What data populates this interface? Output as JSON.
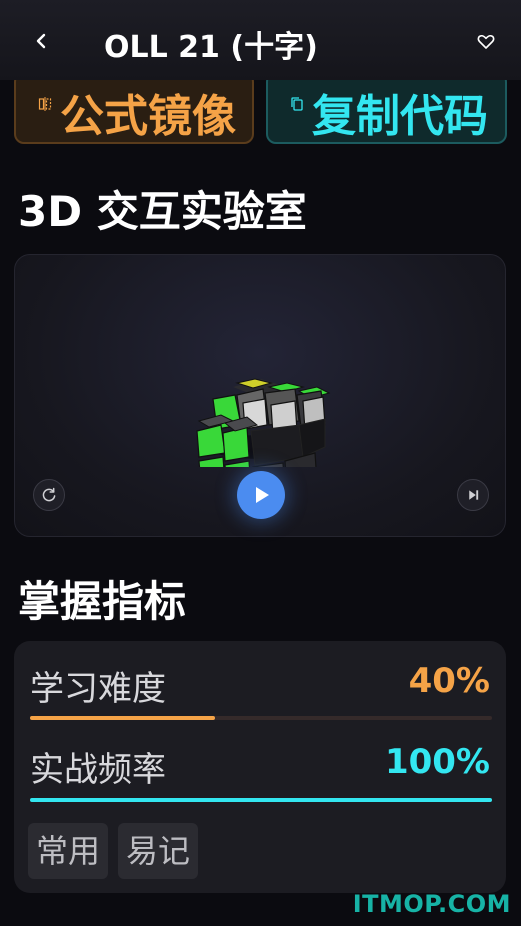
{
  "header": {
    "title": "OLL 21 (十字)",
    "back_icon": "chevron-left-icon",
    "favorite_icon": "heart-outline-icon"
  },
  "actions": {
    "mirror": {
      "label": "公式镜像",
      "icon": "mirror-icon",
      "color": "#f5a347"
    },
    "copy": {
      "label": "复制代码",
      "icon": "copy-icon",
      "color": "#33e6f0"
    }
  },
  "lab": {
    "title": "3D 交互实验室",
    "reset_icon": "reset-icon",
    "play_icon": "play-icon",
    "next_icon": "skip-next-icon"
  },
  "mastery": {
    "title": "掌握指标",
    "metrics": [
      {
        "label": "学习难度",
        "value": "40%",
        "fraction": 0.4,
        "color": "#f5a347"
      },
      {
        "label": "实战频率",
        "value": "100%",
        "fraction": 1.0,
        "color": "#33e6f0"
      }
    ],
    "tags": [
      "常用",
      "易记"
    ]
  },
  "watermark": "ITMOP.COM"
}
